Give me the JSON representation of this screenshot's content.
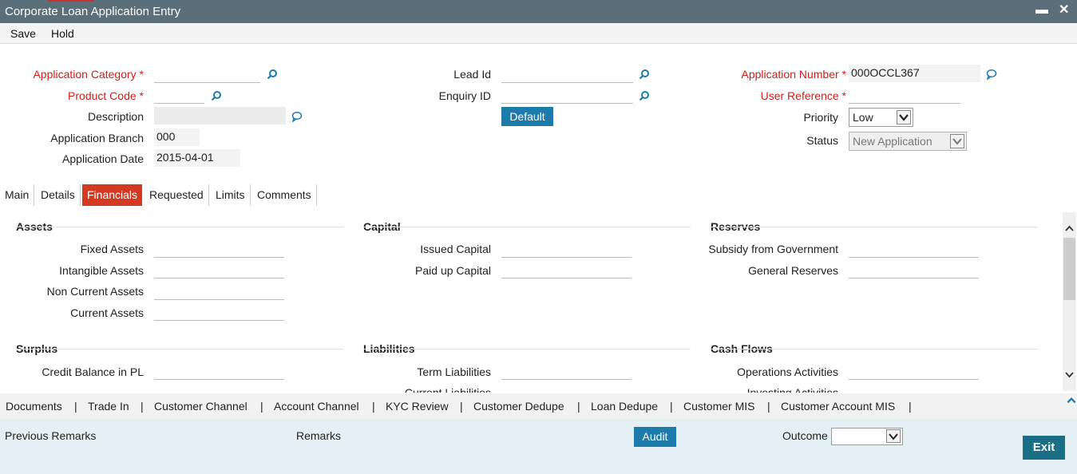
{
  "window": {
    "title": "Corporate Loan Application Entry",
    "minimize_glyph": "▬",
    "close_glyph": "✕"
  },
  "menu": {
    "save": "Save",
    "hold": "Hold"
  },
  "header": {
    "application_category": {
      "label": "Application Category",
      "value": ""
    },
    "product_code": {
      "label": "Product Code",
      "value": ""
    },
    "description": {
      "label": "Description",
      "value": ""
    },
    "application_branch": {
      "label": "Application Branch",
      "value": "000"
    },
    "application_date": {
      "label": "Application Date",
      "value": "2015-04-01"
    },
    "lead_id": {
      "label": "Lead Id",
      "value": ""
    },
    "enquiry_id": {
      "label": "Enquiry ID",
      "value": ""
    },
    "default_button": "Default",
    "application_number": {
      "label": "Application Number",
      "value": "000OCCL367"
    },
    "user_reference": {
      "label": "User Reference",
      "value": ""
    },
    "priority": {
      "label": "Priority",
      "value": "Low"
    },
    "status": {
      "label": "Status",
      "value": "New Application"
    },
    "required_marker": "*"
  },
  "tabs": [
    {
      "label": "Main"
    },
    {
      "label": "Details"
    },
    {
      "label": "Financials",
      "active": true
    },
    {
      "label": "Requested"
    },
    {
      "label": "Limits"
    },
    {
      "label": "Comments"
    }
  ],
  "financials": {
    "assets": {
      "title": "Assets",
      "fields": [
        "Fixed Assets",
        "Intangible Assets",
        "Non Current Assets",
        "Current Assets"
      ]
    },
    "capital": {
      "title": "Capital",
      "fields": [
        "Issued Capital",
        "Paid up Capital"
      ]
    },
    "reserves": {
      "title": "Reserves",
      "fields": [
        "Subsidy from Government",
        "General Reserves"
      ]
    },
    "surplus": {
      "title": "Surplus",
      "fields": [
        "Credit Balance in PL"
      ]
    },
    "liabilities": {
      "title": "Liabilities",
      "fields": [
        "Term Liabilities",
        "Current Liabilities"
      ]
    },
    "cash_flows": {
      "title": "Cash Flows",
      "fields": [
        "Operations Activities",
        "Investing Activities"
      ]
    }
  },
  "bottom_links": [
    "Documents",
    "Trade In",
    "Customer Channel",
    "Account Channel",
    "KYC Review",
    "Customer Dedupe",
    "Loan Dedupe",
    "Customer MIS",
    "Customer Account MIS"
  ],
  "link_separator": "|",
  "footer": {
    "previous_remarks": "Previous Remarks",
    "remarks": "Remarks",
    "audit": "Audit",
    "outcome": "Outcome",
    "outcome_value": "",
    "exit": "Exit"
  },
  "colors": {
    "titlebar": "#5b6f7b",
    "required": "#d0201a",
    "active_tab": "#d43a22",
    "button": "#1c7bab",
    "exit_button": "#1a6f86",
    "footer": "#e4f0f3"
  },
  "icons": {
    "lookup": "search-icon",
    "comment": "comment-bubble-icon",
    "dropdown": "chevron-down-icon"
  }
}
